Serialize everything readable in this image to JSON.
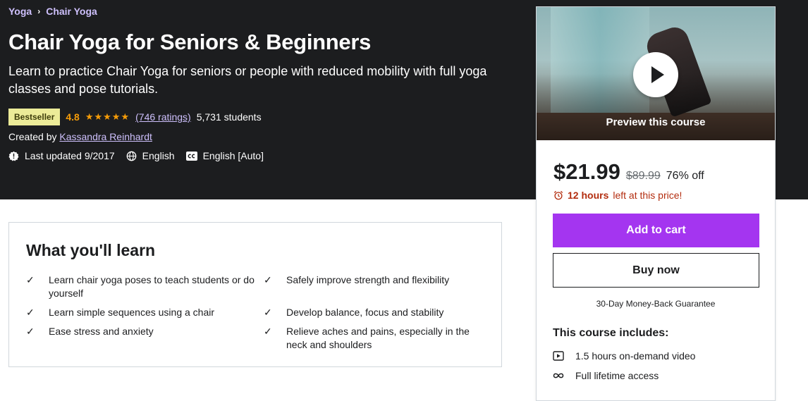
{
  "breadcrumb": {
    "category": "Yoga",
    "separator": "›",
    "subcategory": "Chair Yoga"
  },
  "course": {
    "title": "Chair Yoga for Seniors & Beginners",
    "subtitle": "Learn to practice Chair Yoga for seniors or people with reduced mobility with full yoga classes and pose tutorials.",
    "badge": "Bestseller",
    "rating": "4.8",
    "stars": "★★★★★",
    "ratings_count": "(746 ratings)",
    "students": "5,731 students",
    "created_by_label": "Created by",
    "instructor": "Kassandra Reinhardt",
    "last_updated": "Last updated 9/2017",
    "language": "English",
    "captions": "English [Auto]"
  },
  "learn": {
    "title": "What you'll learn",
    "check_icon": "✓",
    "items": [
      "Learn chair yoga poses to teach students or do yourself",
      "Safely improve strength and flexibility",
      "Learn simple sequences using a chair",
      "Develop balance, focus and stability",
      "Ease stress and anxiety",
      "Relieve aches and pains, especially in the neck and shoulders"
    ]
  },
  "sidebar": {
    "preview_label": "Preview this course",
    "price": "$21.99",
    "old_price": "$89.99",
    "discount": "76% off",
    "timer_bold": "12 hours",
    "timer_rest": "left at this price!",
    "add_to_cart": "Add to cart",
    "buy_now": "Buy now",
    "guarantee": "30-Day Money-Back Guarantee",
    "includes_title": "This course includes:",
    "includes": [
      {
        "icon": "video-icon",
        "label": "1.5 hours on-demand video"
      },
      {
        "icon": "infinity-icon",
        "label": "Full lifetime access"
      }
    ]
  },
  "colors": {
    "hero_bg": "#1c1d1f",
    "link_purple": "#cec0fc",
    "accent_purple": "#a435f0",
    "star_orange": "#f69c08",
    "badge_yellow": "#eceb98",
    "timer_red": "#b32d0f"
  }
}
